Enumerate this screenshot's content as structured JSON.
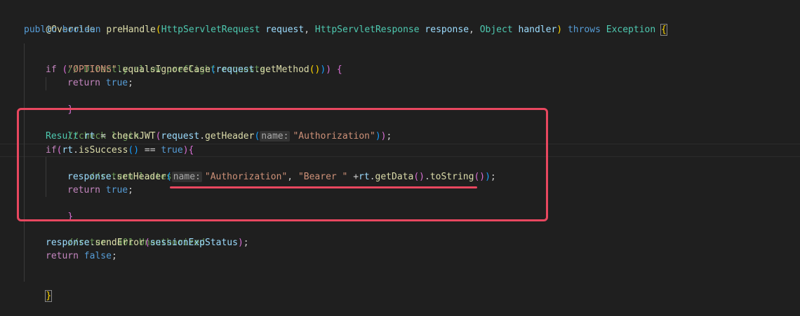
{
  "code": {
    "annotation": "@Override",
    "sig": {
      "public": "public",
      "boolean": "boolean",
      "method": "preHandle",
      "open": "(",
      "t1": "HttpServletRequest",
      "p1": "request",
      "comma1": ",",
      "t2": "HttpServletResponse",
      "p2": "response",
      "comma2": ",",
      "t3": "Object",
      "p3": "handler",
      "close": ")",
      "throws": "throws",
      "exc": "Exception",
      "brace": "{"
    },
    "c1": "// Directly allow preflight requests.",
    "if1": {
      "if": "if",
      "open": "(",
      "str": "\"OPTIONS\"",
      "dot": ".",
      "fn": "equalsIgnoreCase",
      "open2": "(",
      "var": "request",
      "dot2": ".",
      "fn2": "getMethod",
      "paren3": "()",
      "close2": ")",
      "close1": ")",
      "brace": "{"
    },
    "ret1": {
      "kw": "return",
      "val": "true",
      "semi": ";"
    },
    "brace_close1": "}",
    "c2": "//check login",
    "result": {
      "type": "Result",
      "var": "rt",
      "eq": "=",
      "fn": "checkJWT",
      "open": "(",
      "req": "request",
      "dot": ".",
      "fn2": "getHeader",
      "open2": "(",
      "hint": "name:",
      "str": "\"Authorization\"",
      "close2": ")",
      "close1": ")",
      "semi": ";"
    },
    "if2": {
      "if": "if",
      "open": "(",
      "var": "rt",
      "dot": ".",
      "fn": "isSuccess",
      "paren": "()",
      "eq": "==",
      "val": "true",
      "close": ")",
      "brace": "{"
    },
    "c3": "//return lastest jwt",
    "set": {
      "var": "response",
      "dot": ".",
      "fn": "setHeader",
      "open": "(",
      "hint": "name:",
      "str1": "\"Authorization\"",
      "comma": ",",
      "str2": "\"Bearer \"",
      "plus": "+",
      "var2": "rt",
      "dot2": ".",
      "fn2": "getData",
      "paren2": "()",
      "dot3": ".",
      "fn3": "toString",
      "paren3": "()",
      "close": ")",
      "semi": ";"
    },
    "ret2": {
      "kw": "return",
      "val": "true",
      "semi": ";"
    },
    "brace_close2": "}",
    "c4": "//return 401 Unauthorized",
    "send": {
      "var": "response",
      "dot": ".",
      "fn": "sendError",
      "open": "(",
      "arg": "sessionExpStatus",
      "close": ")",
      "semi": ";"
    },
    "ret3": {
      "kw": "return",
      "val": "false",
      "semi": ";"
    },
    "brace_close3": "}"
  },
  "colors": {
    "background": "#1f1f1f",
    "keyword": "#569cd6",
    "control": "#c586c0",
    "type": "#4ec9b0",
    "function": "#dcdcaa",
    "variable": "#9cdcfe",
    "string": "#ce9178",
    "comment": "#6a9955",
    "highlight_box": "#e8475f"
  }
}
